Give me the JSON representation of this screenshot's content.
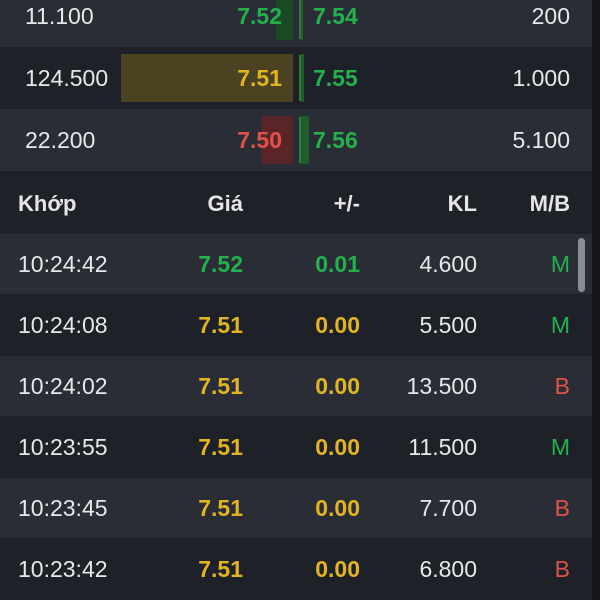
{
  "colors": {
    "green": "#23b14d",
    "yellow": "#e0b422",
    "red": "#e0524a",
    "background": "#1c1f26",
    "row_alt": "#2a2d35"
  },
  "order_book": [
    {
      "bid_vol": "11.100",
      "bid": "7.52",
      "bid_color": "green",
      "ask": "7.54",
      "ask_vol": "200"
    },
    {
      "bid_vol": "124.500",
      "bid": "7.51",
      "bid_color": "yellow",
      "ask": "7.55",
      "ask_vol": "1.000"
    },
    {
      "bid_vol": "22.200",
      "bid": "7.50",
      "bid_color": "red",
      "ask": "7.56",
      "ask_vol": "5.100"
    }
  ],
  "trades_header": {
    "time": "Khớp",
    "price": "Giá",
    "change": "+/-",
    "volume": "KL",
    "side": "M/B"
  },
  "trades": [
    {
      "time": "10:24:42",
      "price": "7.52",
      "change": "0.01",
      "volume": "4.600",
      "side": "M"
    },
    {
      "time": "10:24:08",
      "price": "7.51",
      "change": "0.00",
      "volume": "5.500",
      "side": "M"
    },
    {
      "time": "10:24:02",
      "price": "7.51",
      "change": "0.00",
      "volume": "13.500",
      "side": "B"
    },
    {
      "time": "10:23:55",
      "price": "7.51",
      "change": "0.00",
      "volume": "11.500",
      "side": "M"
    },
    {
      "time": "10:23:45",
      "price": "7.51",
      "change": "0.00",
      "volume": "7.700",
      "side": "B"
    },
    {
      "time": "10:23:42",
      "price": "7.51",
      "change": "0.00",
      "volume": "6.800",
      "side": "B"
    }
  ]
}
